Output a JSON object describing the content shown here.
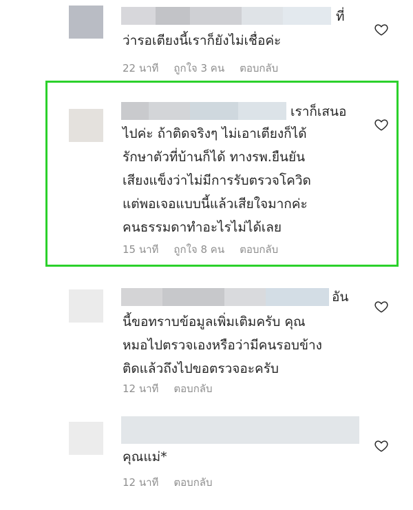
{
  "comments": [
    {
      "tail": "ที่",
      "text": "ว่ารอเตียงนี้เราก็ยังไม่เชื่อค่ะ",
      "time": "22 นาที",
      "likes": "ถูกใจ 3 คน",
      "reply": "ตอบกลับ"
    },
    {
      "tail": "เราก็เสนอ",
      "text": "ไปค่ะ ถ้าติดจริงๆ ไม่เอาเตียงก็ได้\nรักษาตัวที่บ้านก็ได้ ทางรพ.ยืนยัน\nเสียงแข็งว่าไม่มีการรับตรวจโควิด\nแต่พอเจอแบบนี้แล้วเสียใจมากค่ะ\nคนธรรมดาทำอะไรไม่ได้เลย",
      "time": "15 นาที",
      "likes": "ถูกใจ 8 คน",
      "reply": "ตอบกลับ"
    },
    {
      "tail": "อัน",
      "text": "นี้ขอทราบข้อมูลเพิ่มเติมครับ คุณ\nหมอไปตรวจเองหรือว่ามีคนรอบข้าง\nติดแล้วถึงไปขอตรวจอะครับ",
      "time": "12 นาที",
      "reply": "ตอบกลับ"
    },
    {
      "text": "คุณแม่*",
      "time": "12 นาที",
      "reply": "ตอบกลับ"
    }
  ],
  "colors": {
    "highlight": "#2bd12b",
    "meta": "#8e8e8e",
    "text": "#262626"
  },
  "icons": {
    "like": "heart-outline-icon"
  }
}
